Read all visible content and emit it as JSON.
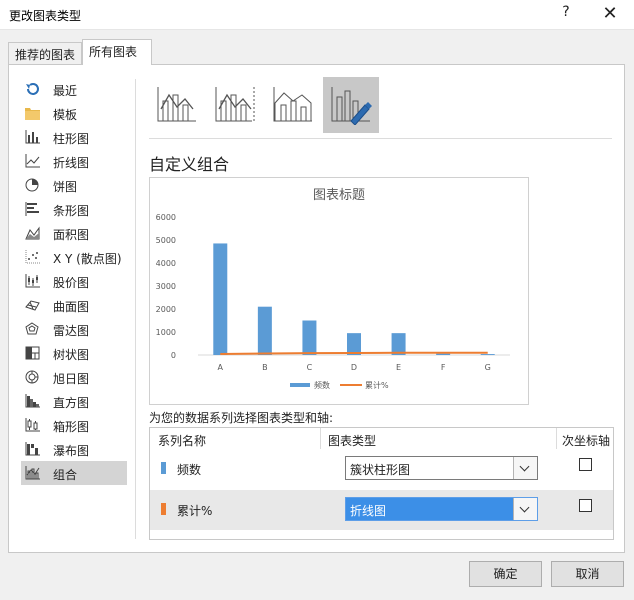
{
  "window": {
    "title": "更改图表类型",
    "help_label": "?",
    "close_label": "✕"
  },
  "tabs": [
    {
      "label": "推荐的图表"
    },
    {
      "label": "所有图表"
    }
  ],
  "nav": {
    "items": [
      {
        "label": "最近",
        "icon": "recent-icon"
      },
      {
        "label": "模板",
        "icon": "folder-icon"
      },
      {
        "label": "柱形图",
        "icon": "column-chart-icon"
      },
      {
        "label": "折线图",
        "icon": "line-chart-icon"
      },
      {
        "label": "饼图",
        "icon": "pie-chart-icon"
      },
      {
        "label": "条形图",
        "icon": "bar-chart-icon"
      },
      {
        "label": "面积图",
        "icon": "area-chart-icon"
      },
      {
        "label": "X Y (散点图)",
        "icon": "scatter-chart-icon"
      },
      {
        "label": "股价图",
        "icon": "stock-chart-icon"
      },
      {
        "label": "曲面图",
        "icon": "surface-chart-icon"
      },
      {
        "label": "雷达图",
        "icon": "radar-chart-icon"
      },
      {
        "label": "树状图",
        "icon": "treemap-chart-icon"
      },
      {
        "label": "旭日图",
        "icon": "sunburst-chart-icon"
      },
      {
        "label": "直方图",
        "icon": "histogram-chart-icon"
      },
      {
        "label": "箱形图",
        "icon": "boxplot-chart-icon"
      },
      {
        "label": "瀑布图",
        "icon": "waterfall-chart-icon"
      },
      {
        "label": "组合",
        "icon": "combo-chart-icon",
        "selected": true
      }
    ]
  },
  "subtypes": [
    {
      "icon": "combo-clustered-column-line-icon"
    },
    {
      "icon": "combo-column-line-secondary-icon"
    },
    {
      "icon": "combo-stacked-area-column-icon"
    },
    {
      "icon": "combo-custom-icon",
      "selected": true
    }
  ],
  "section_title": "自定义组合",
  "chart_data": {
    "type": "bar",
    "title": "图表标题",
    "categories": [
      "A",
      "B",
      "C",
      "D",
      "E",
      "F",
      "G"
    ],
    "series": [
      {
        "name": "频数",
        "type": "bar",
        "color": "#5b9bd5",
        "values": [
          4850,
          2100,
          1500,
          950,
          950,
          60,
          40
        ]
      },
      {
        "name": "累计%",
        "type": "line",
        "color": "#ed7d31",
        "values": [
          45,
          65,
          80,
          89,
          98,
          99,
          100
        ]
      }
    ],
    "ylim": [
      0,
      6000
    ],
    "yticks": [
      0,
      1000,
      2000,
      3000,
      4000,
      5000,
      6000
    ],
    "legend": "bottom",
    "grid": false
  },
  "choose_label": "为您的数据系列选择图表类型和轴:",
  "table": {
    "col_name": "系列名称",
    "col_type": "图表类型",
    "col_axis": "次坐标轴",
    "rows": [
      {
        "name": "频数",
        "color": "#5b9bd5",
        "type": "簇状柱形图",
        "secondary": false
      },
      {
        "name": "累计%",
        "color": "#ed7d31",
        "type": "折线图",
        "secondary": false
      }
    ]
  },
  "buttons": {
    "ok": "确定",
    "cancel": "取消"
  }
}
